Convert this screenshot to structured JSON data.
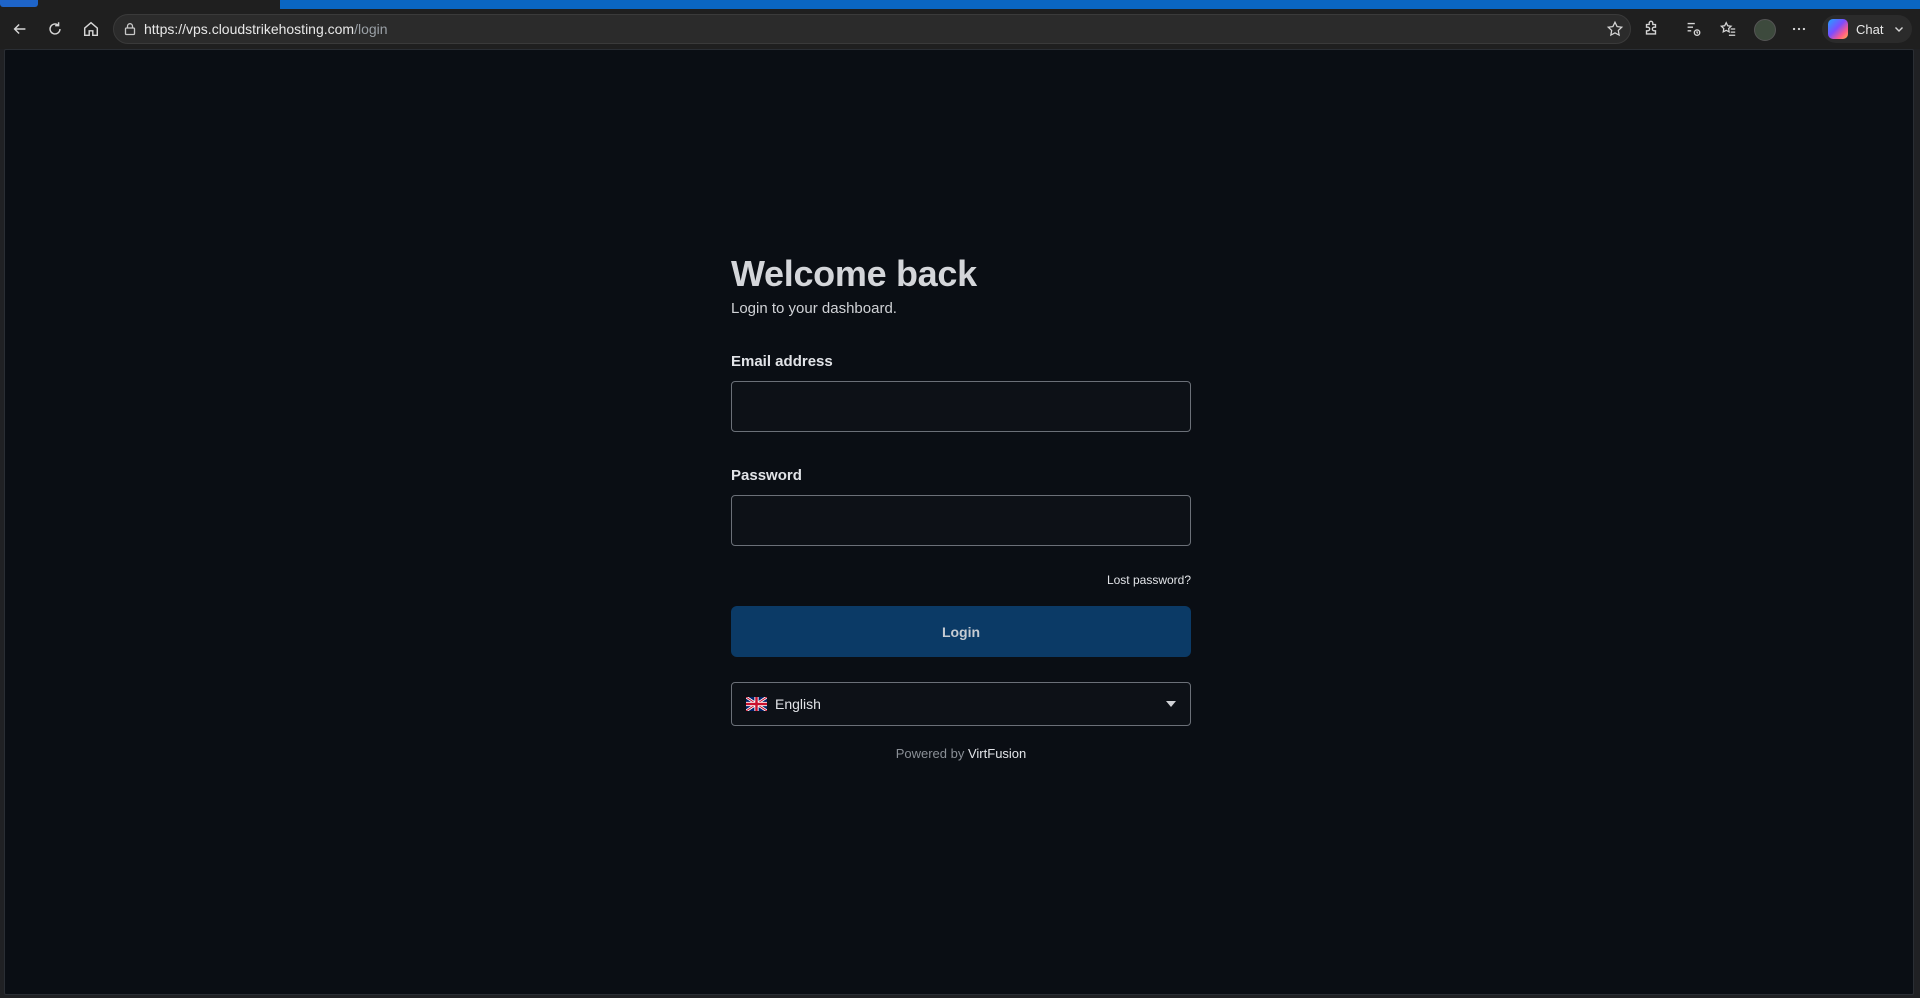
{
  "browser": {
    "url_host": "https://vps.cloudstrikehosting.com",
    "url_path": "/login",
    "chat_label": "Chat"
  },
  "login": {
    "title": "Welcome back",
    "subtitle": "Login to your dashboard.",
    "email_label": "Email address",
    "email_value": "",
    "password_label": "Password",
    "password_value": "",
    "lost_password": "Lost password?",
    "submit_label": "Login",
    "language": "English",
    "powered_prefix": "Powered by",
    "powered_brand": "VirtFusion"
  },
  "colors": {
    "page_bg": "#0a0e14",
    "button_bg": "#0b3a66",
    "browser_accent": "#0a66c2"
  }
}
